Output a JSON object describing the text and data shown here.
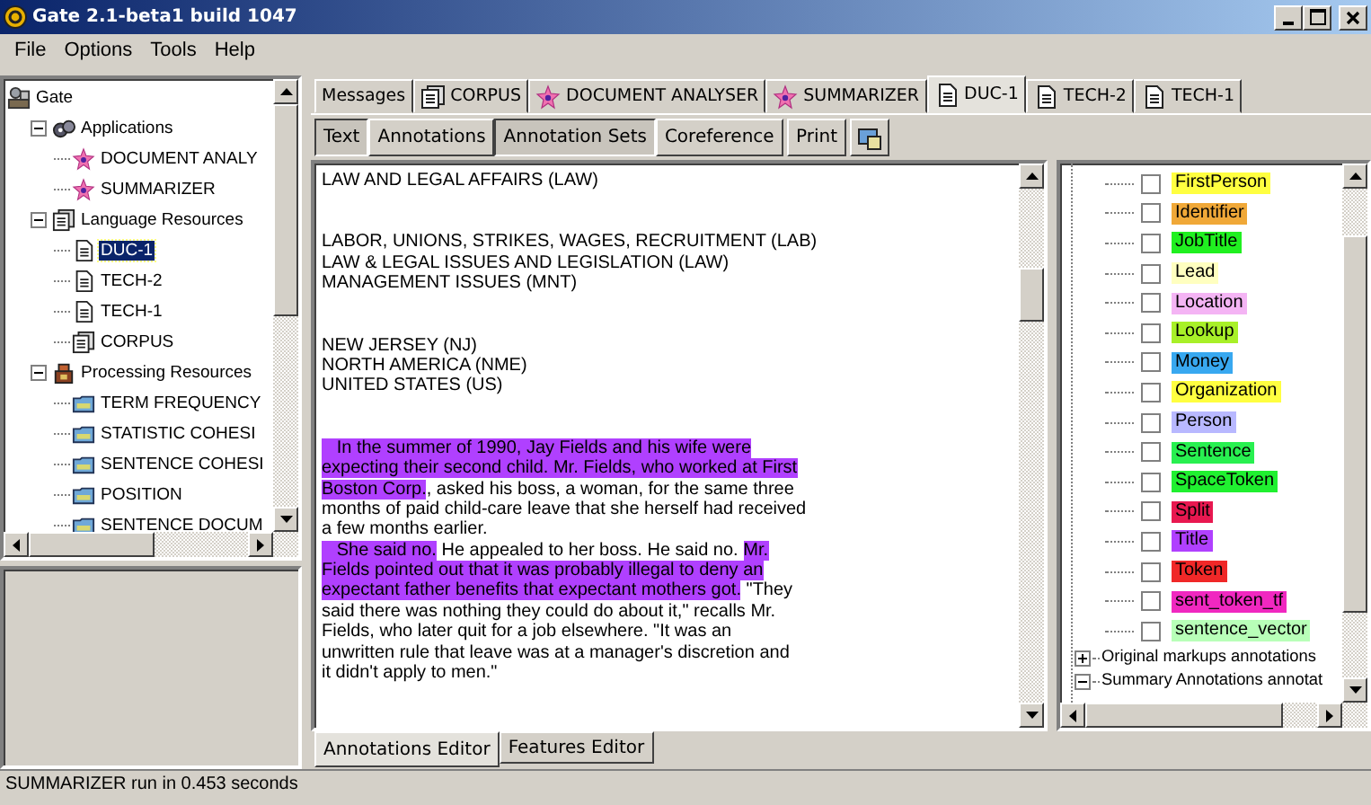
{
  "window": {
    "title": "Gate 2.1-beta1 build 1047"
  },
  "menu": [
    "File",
    "Options",
    "Tools",
    "Help"
  ],
  "resource_tree": {
    "label": "Gate",
    "kind": "root",
    "selected": false,
    "children": [
      {
        "label": "Applications",
        "kind": "applications",
        "expanded": true,
        "selected": false,
        "children": [
          {
            "label": "DOCUMENT ANALY",
            "kind": "application",
            "selected": false
          },
          {
            "label": "SUMMARIZER",
            "kind": "application",
            "selected": false
          }
        ]
      },
      {
        "label": "Language Resources",
        "kind": "corpus",
        "expanded": true,
        "selected": false,
        "children": [
          {
            "label": "DUC-1",
            "kind": "document",
            "selected": true
          },
          {
            "label": "TECH-2",
            "kind": "document",
            "selected": false
          },
          {
            "label": "TECH-1",
            "kind": "document",
            "selected": false
          },
          {
            "label": "CORPUS",
            "kind": "corpus",
            "selected": false
          }
        ]
      },
      {
        "label": "Processing Resources",
        "kind": "processing",
        "expanded": true,
        "selected": false,
        "children": [
          {
            "label": "TERM FREQUENCY",
            "kind": "resource",
            "selected": false
          },
          {
            "label": "STATISTIC COHESI",
            "kind": "resource",
            "selected": false
          },
          {
            "label": "SENTENCE COHESI",
            "kind": "resource",
            "selected": false
          },
          {
            "label": "POSITION",
            "kind": "resource",
            "selected": false
          },
          {
            "label": "SENTENCE DOCUM",
            "kind": "resource",
            "selected": false
          }
        ]
      }
    ]
  },
  "tabs": [
    {
      "label": "Messages",
      "kind": "log",
      "selected": false
    },
    {
      "label": "CORPUS",
      "kind": "corpus",
      "selected": false
    },
    {
      "label": "DOCUMENT ANALYSER",
      "kind": "application",
      "selected": false
    },
    {
      "label": "SUMMARIZER",
      "kind": "application",
      "selected": false
    },
    {
      "label": "DUC-1",
      "kind": "document",
      "selected": true
    },
    {
      "label": "TECH-2",
      "kind": "document",
      "selected": false
    },
    {
      "label": "TECH-1",
      "kind": "document",
      "selected": false
    }
  ],
  "view_toggles": [
    {
      "label": "Text",
      "selected": true
    },
    {
      "label": "Annotations",
      "selected": false
    },
    {
      "label": "Annotation Sets",
      "selected": true
    },
    {
      "label": "Coreference",
      "selected": false
    }
  ],
  "print_button": "Print",
  "document_text": [
    {
      "lines": [
        [
          {
            "text": "LAW AND LEGAL AFFAIRS (LAW)",
            "highlighted": false
          }
        ]
      ]
    },
    {
      "lines": [
        [
          {
            "text": "LABOR, UNIONS, STRIKES, WAGES, RECRUITMENT (LAB)",
            "highlighted": false
          }
        ],
        [
          {
            "text": "LAW & LEGAL ISSUES AND LEGISLATION (LAW)",
            "highlighted": false
          }
        ],
        [
          {
            "text": "MANAGEMENT ISSUES (MNT)",
            "highlighted": false
          }
        ]
      ]
    },
    {
      "lines": [
        [
          {
            "text": "NEW JERSEY (NJ)",
            "highlighted": false
          }
        ],
        [
          {
            "text": "NORTH AMERICA (NME)",
            "highlighted": false
          }
        ],
        [
          {
            "text": "UNITED STATES (US)",
            "highlighted": false
          }
        ]
      ]
    },
    {
      "lines": [
        [
          {
            "text": "   In the summer of 1990, Jay Fields and his wife were",
            "highlighted": true
          }
        ],
        [
          {
            "text": "expecting their second child. ",
            "highlighted": true
          },
          {
            "text": "Mr. Fields, who worked at First",
            "highlighted": true
          }
        ],
        [
          {
            "text": "Boston Corp.",
            "highlighted": true
          },
          {
            "text": ", asked his boss, a woman, for the same three",
            "highlighted": false
          }
        ],
        [
          {
            "text": "months of paid child-care leave that she herself had received",
            "highlighted": false
          }
        ],
        [
          {
            "text": "a few months earlier.",
            "highlighted": false
          }
        ],
        [
          {
            "text": "   She said no.",
            "highlighted": true
          },
          {
            "text": " He appealed to her boss. He said no. ",
            "highlighted": false
          },
          {
            "text": "Mr.",
            "highlighted": true
          }
        ],
        [
          {
            "text": "Fields pointed out that it was probably illegal to deny an",
            "highlighted": true
          }
        ],
        [
          {
            "text": "expectant father benefits that expectant mothers got.",
            "highlighted": true
          },
          {
            "text": " \"They",
            "highlighted": false
          }
        ],
        [
          {
            "text": "said there was nothing they could do about it,\" recalls Mr.",
            "highlighted": false
          }
        ],
        [
          {
            "text": "Fields, who later quit for a job elsewhere. \"It was an",
            "highlighted": false
          }
        ],
        [
          {
            "text": "unwritten rule that leave was at a manager's discretion and",
            "highlighted": false
          }
        ],
        [
          {
            "text": "it didn't apply to men.\"",
            "highlighted": false
          }
        ]
      ]
    }
  ],
  "annotation_tree": {
    "types": [
      {
        "label": "FirstPerson",
        "color": "#ffff40",
        "checked": false
      },
      {
        "label": "Identifier",
        "color": "#f0a838",
        "checked": false
      },
      {
        "label": "JobTitle",
        "color": "#20f020",
        "checked": false
      },
      {
        "label": "Lead",
        "color": "#ffffc0",
        "checked": false
      },
      {
        "label": "Location",
        "color": "#f4b4f4",
        "checked": false
      },
      {
        "label": "Lookup",
        "color": "#a8f028",
        "checked": false
      },
      {
        "label": "Money",
        "color": "#38a8f0",
        "checked": false
      },
      {
        "label": "Organization",
        "color": "#ffff40",
        "checked": false
      },
      {
        "label": "Person",
        "color": "#b8b8ff",
        "checked": false
      },
      {
        "label": "Sentence",
        "color": "#28f050",
        "checked": false
      },
      {
        "label": "SpaceToken",
        "color": "#20f030",
        "checked": false
      },
      {
        "label": "Split",
        "color": "#e81850",
        "checked": false
      },
      {
        "label": "Title",
        "color": "#b040ff",
        "checked": false
      },
      {
        "label": "Token",
        "color": "#f02828",
        "checked": false
      },
      {
        "label": "sent_token_tf",
        "color": "#f028c0",
        "checked": false
      },
      {
        "label": "sentence_vector",
        "color": "#b8ffb8",
        "checked": false
      }
    ],
    "sets": [
      {
        "label": "Original markups annotations",
        "expanded": false
      },
      {
        "label": "Summary Annotations annotat",
        "expanded": true
      }
    ]
  },
  "editor_tabs": [
    {
      "label": "Annotations Editor",
      "selected": true
    },
    {
      "label": "Features Editor",
      "selected": false
    }
  ],
  "status_bar": "SUMMARIZER run in 0.453 seconds"
}
